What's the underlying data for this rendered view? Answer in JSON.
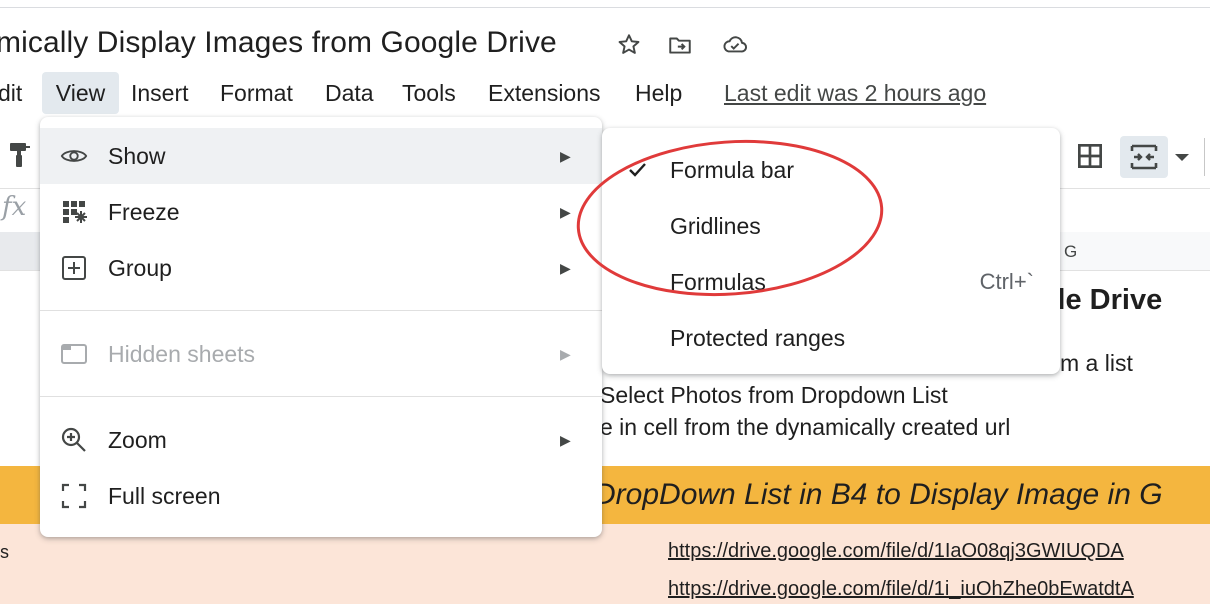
{
  "doc": {
    "title": "mically Display Images from Google Drive"
  },
  "menubar": {
    "items": [
      "dit",
      "View",
      "Insert",
      "Format",
      "Data",
      "Tools",
      "Extensions",
      "Help"
    ],
    "last_edit": "Last edit was 2 hours ago"
  },
  "formula_bar": {
    "fx": "fx"
  },
  "sheet": {
    "column_g": "G",
    "heading": "ogle Drive",
    "line1": "m a list",
    "line2": "Select Photos from Dropdown List",
    "line3": "e in cell from the dynamically created url",
    "banner": "DropDown List in B4 to Display Image in G",
    "row_label": "s",
    "link1": "https://drive.google.com/file/d/1IaO08qj3GWIUQDA",
    "link2": "https://drive.google.com/file/d/1i_iuOhZhe0bEwatdtA"
  },
  "view_menu": {
    "items": [
      {
        "label": "Show",
        "icon": "eye-icon"
      },
      {
        "label": "Freeze",
        "icon": "freeze-grid-icon"
      },
      {
        "label": "Group",
        "icon": "plus-box-icon"
      },
      {
        "label": "Hidden sheets",
        "icon": "hidden-sheet-icon",
        "disabled": true
      },
      {
        "label": "Zoom",
        "icon": "zoom-in-icon"
      },
      {
        "label": "Full screen",
        "icon": "fullscreen-icon"
      }
    ]
  },
  "show_submenu": {
    "items": [
      {
        "label": "Formula bar",
        "checked": true,
        "shortcut": ""
      },
      {
        "label": "Gridlines",
        "checked": false,
        "shortcut": ""
      },
      {
        "label": "Formulas",
        "checked": false,
        "shortcut": "Ctrl+`"
      },
      {
        "label": "Protected ranges",
        "checked": false,
        "shortcut": ""
      }
    ]
  },
  "colors": {
    "banner": "#f4b63f",
    "peach": "#fce5d8",
    "annotation": "#e03a3a",
    "menu_hover": "#eff1f3"
  }
}
